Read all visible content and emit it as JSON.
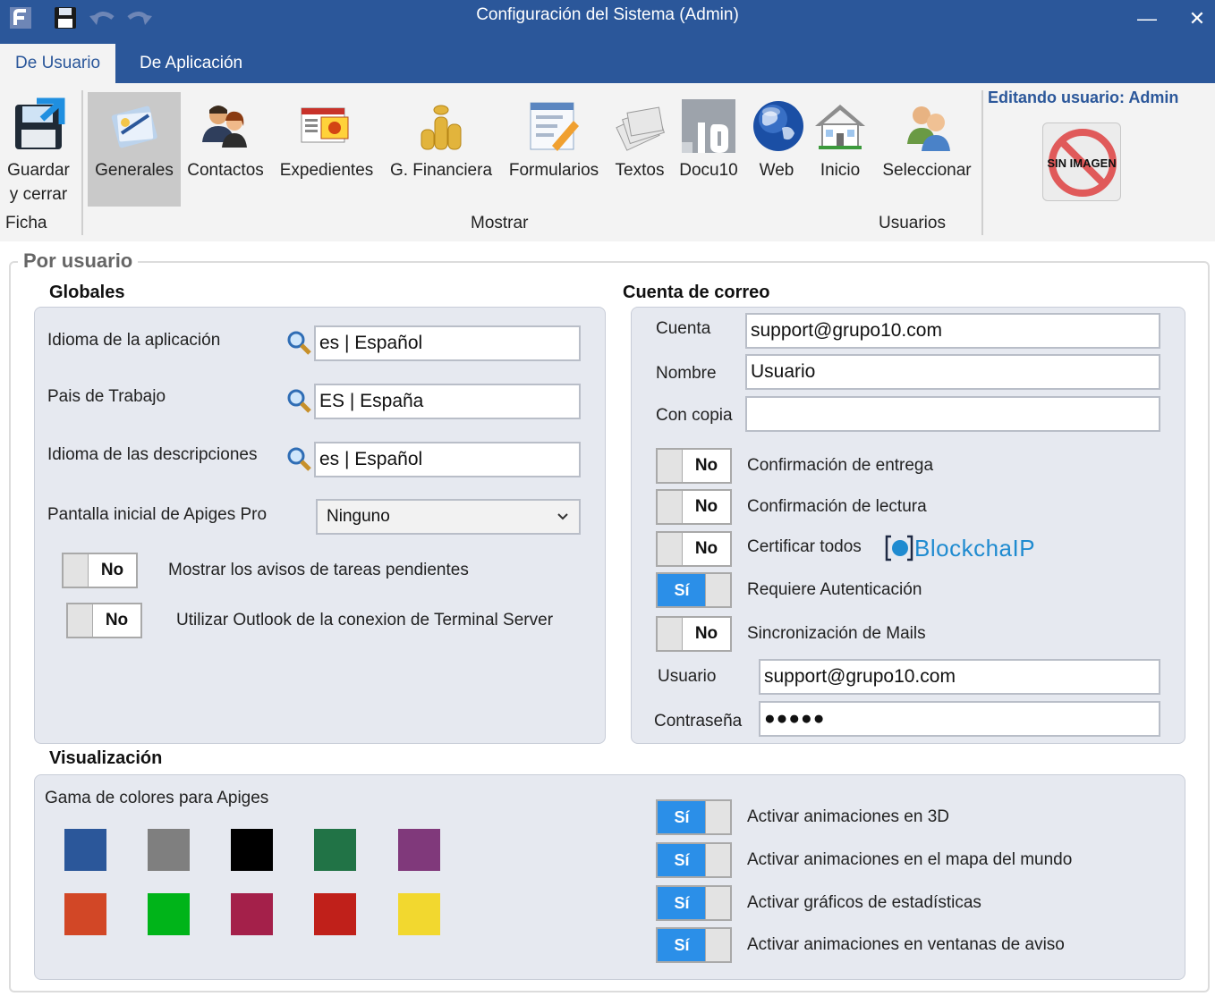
{
  "window": {
    "title": "Configuración del Sistema (Admin)",
    "minimize_glyph": "—",
    "close_glyph": "✕"
  },
  "quick_access": [
    "app-logo-icon",
    "save-icon",
    "undo-icon",
    "redo-icon"
  ],
  "tabs": [
    {
      "label": "De Usuario",
      "active": true
    },
    {
      "label": "De Aplicación",
      "active": false
    }
  ],
  "ribbon": {
    "save_close": {
      "line1": "Guardar",
      "line2": "y cerrar"
    },
    "groups": {
      "ficha": "Ficha",
      "mostrar": "Mostrar",
      "usuarios": "Usuarios"
    },
    "buttons": {
      "generales": "Generales",
      "contactos": "Contactos",
      "expedientes": "Expedientes",
      "financiera": "G. Financiera",
      "formularios": "Formularios",
      "textos": "Textos",
      "docu10": "Docu10",
      "web": "Web",
      "inicio": "Inicio",
      "seleccionar": "Seleccionar"
    },
    "editing_user": "Editando usuario: Admin",
    "no_image": "SIN IMAGEN"
  },
  "section": {
    "title": "Por usuario",
    "globales": {
      "title": "Globales",
      "idioma_label": "Idioma de la aplicación",
      "idioma_value": "es | Español",
      "pais_label": "Pais de Trabajo",
      "pais_value": "ES | España",
      "idioma_desc_label": "Idioma de las descripciones",
      "idioma_desc_value": "es | Español",
      "pantalla_label": "Pantalla inicial de Apiges Pro",
      "pantalla_value": "Ninguno",
      "avisos_toggle": "No",
      "avisos_label": "Mostrar los avisos de tareas pendientes",
      "outlook_toggle": "No",
      "outlook_label": "Utilizar Outlook de la conexion de Terminal Server"
    },
    "correo": {
      "title": "Cuenta de correo",
      "cuenta_label": "Cuenta",
      "cuenta_value": "support@grupo10.com",
      "nombre_label": "Nombre",
      "nombre_value": "Usuario",
      "copia_label": "Con copia",
      "copia_value": "",
      "toggles": [
        {
          "state": "No",
          "on": false,
          "label": "Confirmación de entrega"
        },
        {
          "state": "No",
          "on": false,
          "label": "Confirmación de lectura"
        },
        {
          "state": "No",
          "on": false,
          "label": "Certificar todos"
        },
        {
          "state": "Sí",
          "on": true,
          "label": "Requiere Autenticación"
        },
        {
          "state": "No",
          "on": false,
          "label": "Sincronización de Mails"
        }
      ],
      "blockchain_logo": "BlockchaIP",
      "usuario_label": "Usuario",
      "usuario_value": "support@grupo10.com",
      "password_label": "Contraseña",
      "password_value": "●●●●●"
    },
    "visualizacion": {
      "title": "Visualización",
      "gama_label": "Gama de colores para Apiges",
      "colors": [
        "#2b579a",
        "#7f7f7f",
        "#000000",
        "#217346",
        "#80397b",
        "#d24726",
        "#00b419",
        "#a4204a",
        "#c0201a",
        "#f2d82f"
      ],
      "toggles": [
        {
          "state": "Sí",
          "on": true,
          "label": "Activar animaciones en 3D"
        },
        {
          "state": "Sí",
          "on": true,
          "label": "Activar animaciones en el mapa del mundo"
        },
        {
          "state": "Sí",
          "on": true,
          "label": "Activar gráficos de estadísticas"
        },
        {
          "state": "Sí",
          "on": true,
          "label": "Activar animaciones en ventanas de aviso"
        }
      ]
    }
  }
}
